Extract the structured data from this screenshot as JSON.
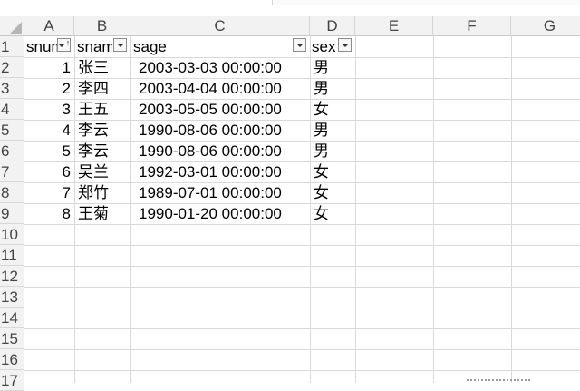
{
  "columns": [
    "A",
    "B",
    "C",
    "D",
    "E",
    "F",
    "G"
  ],
  "rows": [
    "1",
    "2",
    "3",
    "4",
    "5",
    "6",
    "7",
    "8",
    "9",
    "10",
    "11",
    "12",
    "13",
    "14",
    "15",
    "16",
    "17"
  ],
  "header_row": {
    "sno": "snum",
    "sname": "snam",
    "sage": "sage",
    "sex": "sex"
  },
  "records": [
    {
      "sno": "1",
      "sname": "张三",
      "sage": "2003-03-03 00:00:00",
      "sex": "男"
    },
    {
      "sno": "2",
      "sname": "李四",
      "sage": "2003-04-04 00:00:00",
      "sex": "男"
    },
    {
      "sno": "3",
      "sname": "王五",
      "sage": "2003-05-05 00:00:00",
      "sex": "女"
    },
    {
      "sno": "4",
      "sname": "李云",
      "sage": "1990-08-06 00:00:00",
      "sex": "男"
    },
    {
      "sno": "5",
      "sname": "李云",
      "sage": "1990-08-06 00:00:00",
      "sex": "男"
    },
    {
      "sno": "6",
      "sname": "吴兰",
      "sage": "1992-03-01 00:00:00",
      "sex": "女"
    },
    {
      "sno": "7",
      "sname": "郑竹",
      "sage": "1989-07-01 00:00:00",
      "sex": "女"
    },
    {
      "sno": "8",
      "sname": "王菊",
      "sage": "1990-01-20 00:00:00",
      "sex": "女"
    }
  ],
  "filter_icons": {
    "sno": "sort-ascending-filter-icon",
    "others": "dropdown-filter-icon"
  },
  "colors": {
    "header_bg": "#f2f2f2",
    "grid": "#d9d9d9",
    "text": "#000000"
  }
}
